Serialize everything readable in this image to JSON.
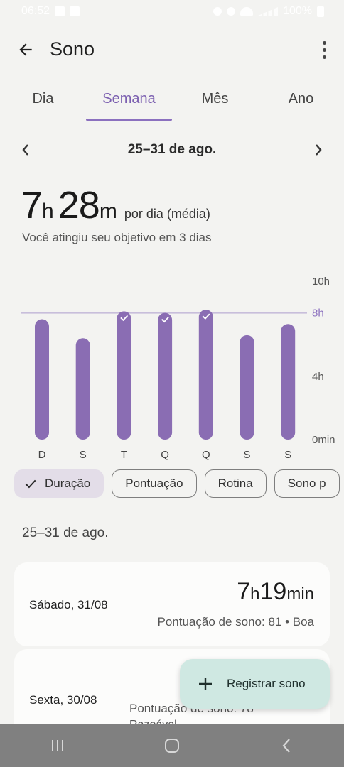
{
  "status_bar": {
    "time": "06:52",
    "battery": "100%"
  },
  "app_bar": {
    "title": "Sono"
  },
  "tabs": [
    {
      "label": "Dia",
      "active": false
    },
    {
      "label": "Semana",
      "active": true
    },
    {
      "label": "Mês",
      "active": false
    },
    {
      "label": "Ano",
      "active": false
    }
  ],
  "date_nav": {
    "label": "25–31 de ago."
  },
  "summary": {
    "hours": "7",
    "hours_unit": "h",
    "minutes": "28",
    "minutes_unit": "m",
    "per_day": "por dia (média)",
    "goal_text": "Você atingiu seu objetivo em 3 dias"
  },
  "chart_data": {
    "type": "bar",
    "categories": [
      "D",
      "S",
      "T",
      "Q",
      "Q",
      "S",
      "S"
    ],
    "values": [
      7.6,
      6.4,
      8.1,
      8.0,
      8.2,
      6.6,
      7.3
    ],
    "goal_met": [
      false,
      false,
      true,
      true,
      true,
      false,
      false
    ],
    "y_ticks": [
      {
        "value": 10,
        "label": "10h"
      },
      {
        "value": 8,
        "label": "8h"
      },
      {
        "value": 4,
        "label": "4h"
      },
      {
        "value": 0,
        "label": "0min"
      }
    ],
    "goal_value": 8,
    "ylim": [
      0,
      10
    ],
    "colors": {
      "bar": "#8a6db3",
      "goal_line": "#c8bedb",
      "goal_label": "#8b70bf",
      "check": "#ffffff"
    }
  },
  "chips": [
    {
      "label": "Duração",
      "selected": true
    },
    {
      "label": "Pontuação",
      "selected": false
    },
    {
      "label": "Rotina",
      "selected": false
    },
    {
      "label": "Sono p",
      "selected": false
    }
  ],
  "section": {
    "title": "25–31 de ago."
  },
  "entries": [
    {
      "day": "Sábado, 31/08",
      "hours": "7",
      "hours_unit": "h",
      "minutes": "19",
      "minutes_unit": "min",
      "score": "Pontuação de sono: 81 • Boa"
    },
    {
      "day": "Sexta, 30/08",
      "score": "Pontuação de sono: 78",
      "sub": "Razoável"
    }
  ],
  "fab": {
    "label": "Registrar sono"
  },
  "colors": {
    "accent": "#8b70bf",
    "background": "#f3f3f1",
    "card": "#fcfcfb",
    "fab": "#cfe8e2",
    "nav_bar": "#808080"
  }
}
